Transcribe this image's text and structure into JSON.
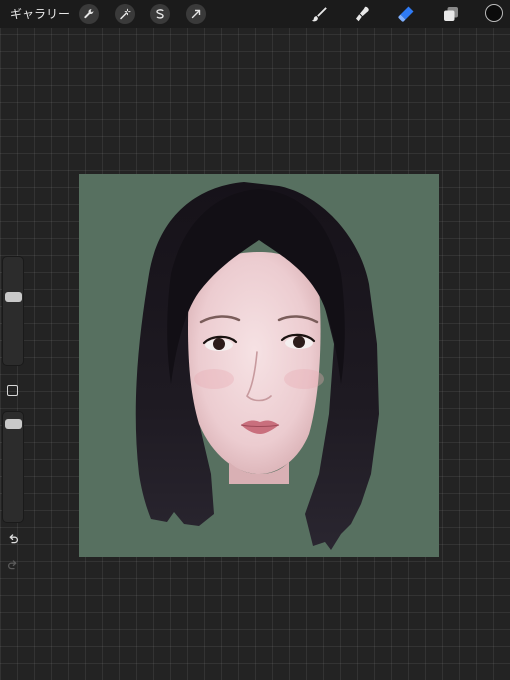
{
  "toolbar": {
    "gallery_label": "ギャラリー",
    "left_tools": [
      "wrench-icon",
      "magic-wand-icon",
      "selection-icon",
      "transform-arrow-icon"
    ],
    "right_tools": [
      "brush-icon",
      "smudge-icon",
      "eraser-icon",
      "layers-icon"
    ],
    "active_tool": "eraser-icon",
    "accent_color": "#2f7bf5",
    "current_color": "#0b0b0b"
  },
  "sidebar": {
    "brush_size_level": 0.65,
    "opacity_level": 0.95,
    "modify_icon": "square-outline-icon",
    "undo_icon": "undo-arrow-icon",
    "redo_icon": "redo-arrow-icon"
  },
  "canvas": {
    "background_color": "#577060",
    "artwork": "portrait-painting"
  }
}
